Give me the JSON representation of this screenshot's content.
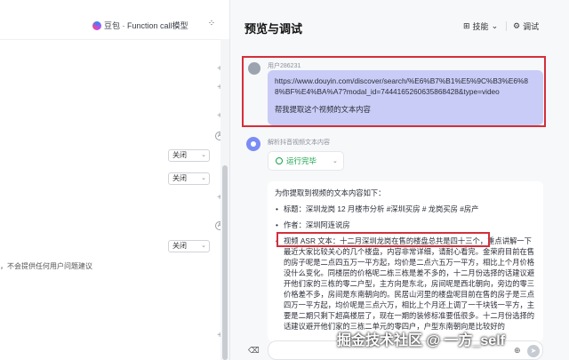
{
  "left": {
    "model_name": "豆包 · Function call模型",
    "grid_icon": "grid-icon",
    "select_value": "关闭",
    "select_off_1": "关闭",
    "select_off_2": "关闭",
    "select_off_3": "关闭",
    "circle_icon_label": "A",
    "hint": "，不会提供任何用户问题建议"
  },
  "right": {
    "title": "预览与调试",
    "skills_label": "技能",
    "debug_label": "调试",
    "user_name": "用户286231",
    "user_url": "https://www.douyin.com/discover/search/%E6%B7%B1%E5%9C%B3%E6%88%BF%E4%BA%A7?modal_id=7444165260635868428&type=video",
    "user_question": "帮我提取这个视频的文本内容",
    "bot_name": "解析抖音视频文本内容",
    "run_status": "运行完毕",
    "answer_intro": "为你提取到视频的文本内容如下：",
    "answer_items": [
      {
        "label": "标题：深圳龙岗 12 月楼市分析 #深圳买房 # 龙岗买房 #房产"
      },
      {
        "label": "作者：深圳阿连说房"
      },
      {
        "label": "视频 ASR 文本：十二月深圳龙岗在售的楼盘总共是四十三个，重点讲解一下最近大家比较关心的几个楼盘，内容非常详细，请耐心看完。金荣府目前在售的房子呢是二点四五万一平方起，均价是二点六五万一平方，相比上个月价格没什么变化。同楼层的价格呢二栋三栋是差不多的，十二月份选择的话建议避开他们家的三栋的零二户型，主方向是东北，房间呢是西北朝向，旁边的零三价格差不多，房间是东南朝向的。民居山河里的楼盘呢目前在售的房子是三点四万一平方起，均价呢是三点六万，相比上个月还上调了一千块钱一平方，主要是二期只剩下超高楼层了，现在一期的装修标准要低很多。十二月份选择的话建议避开他们家的三栋二单元的零四户，户型东南朝向是比较好的"
      }
    ],
    "input_placeholder": "",
    "watermark": "掘金技术社区 @ 一方_self"
  }
}
